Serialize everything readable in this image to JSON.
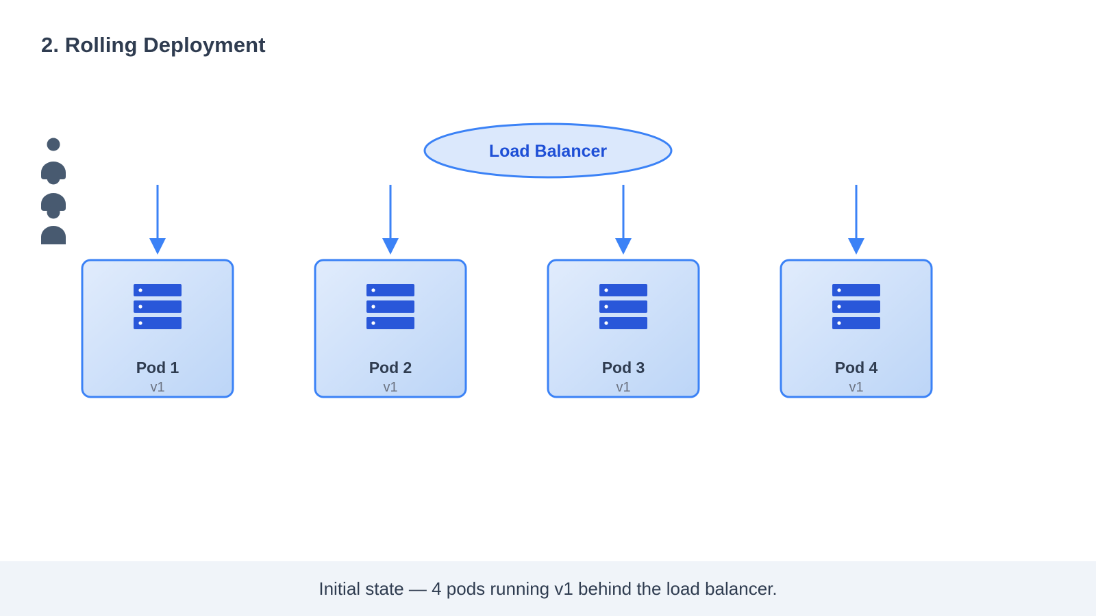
{
  "title": "2. Rolling Deployment",
  "load_balancer": {
    "label": "Load Balancer"
  },
  "users": {
    "count": 4,
    "icon": "user-icon"
  },
  "pods": [
    {
      "name": "Pod 1",
      "version": "v1",
      "icon": "server-icon"
    },
    {
      "name": "Pod 2",
      "version": "v1",
      "icon": "server-icon"
    },
    {
      "name": "Pod 3",
      "version": "v1",
      "icon": "server-icon"
    },
    {
      "name": "Pod 4",
      "version": "v1",
      "icon": "server-icon"
    }
  ],
  "caption": "Initial state — 4 pods running v1 behind the load balancer.",
  "colors": {
    "accent": "#3b82f6",
    "accent_dark": "#1e4fd6",
    "pod_fill_light": "#ddeafc",
    "pod_fill_dark": "#bcd6f8",
    "lb_fill": "#dbe8fc",
    "text_dark": "#2f3c50",
    "text_muted": "#6b7280",
    "user_icon": "#485a70",
    "caption_bg": "#f0f4f9"
  }
}
